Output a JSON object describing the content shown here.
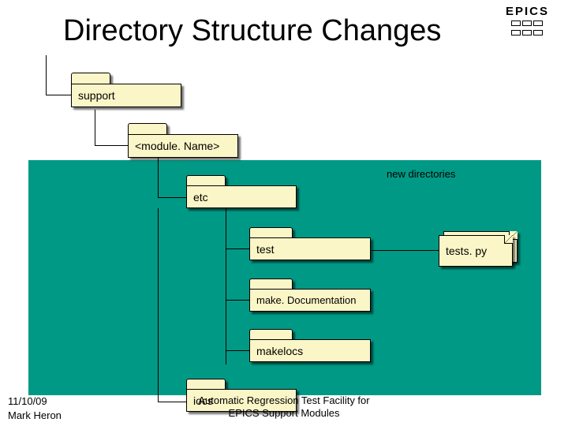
{
  "title": "Directory Structure Changes",
  "epics": "EPICS",
  "folders": {
    "support": "support",
    "moduleName": "<module. Name>",
    "etc": "etc",
    "test": "test",
    "makeDocumentation": "make. Documentation",
    "makeIocs": "makelocs",
    "iocs": "iocs"
  },
  "files": {
    "testsPy": "tests. py"
  },
  "labels": {
    "newDirectories": "new directories"
  },
  "footer": {
    "date": "11/10/09",
    "author": "Mark Heron",
    "subtitle": "Automatic Regression Test Facility for\nEPICS Support Modules"
  }
}
